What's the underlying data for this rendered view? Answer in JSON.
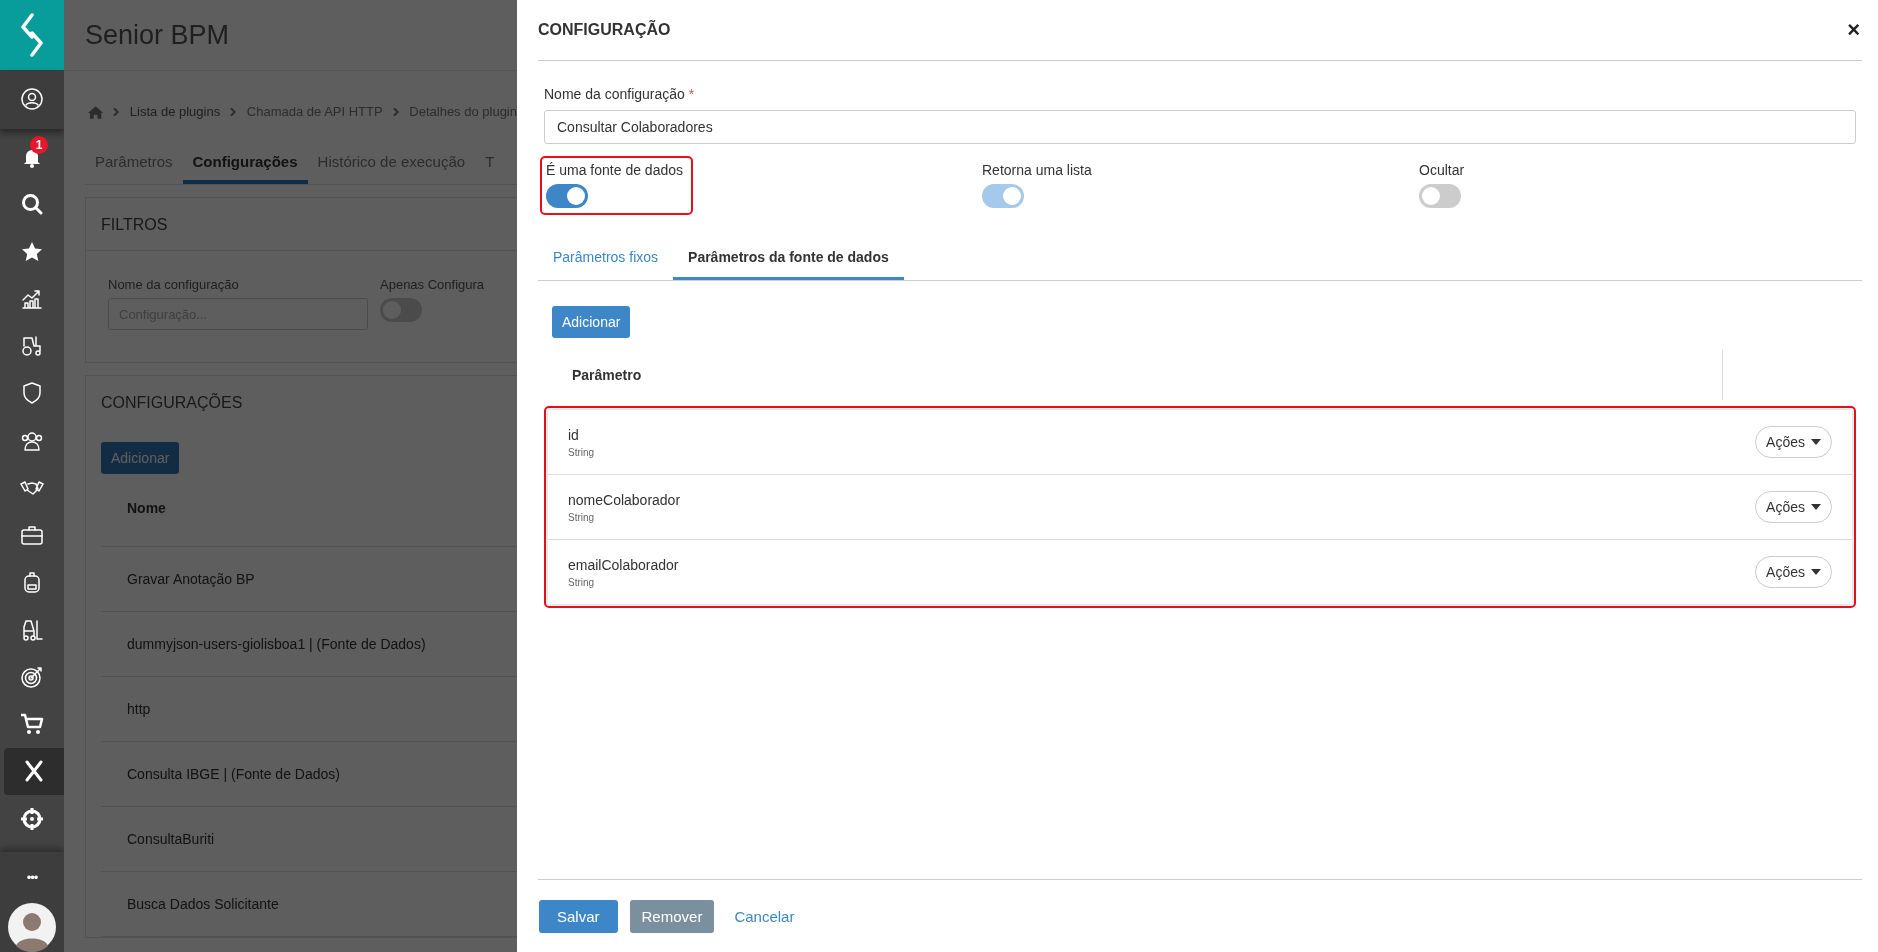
{
  "sidebar": {
    "notification_count": "1",
    "items": [
      {
        "selected": false
      },
      {
        "selected": false
      },
      {
        "selected": false
      },
      {
        "selected": false
      },
      {
        "selected": false
      },
      {
        "selected": false
      },
      {
        "selected": false
      },
      {
        "selected": false
      },
      {
        "selected": false
      },
      {
        "selected": false
      },
      {
        "selected": false
      },
      {
        "selected": false
      },
      {
        "selected": false
      },
      {
        "selected": false
      },
      {
        "selected": true
      },
      {
        "selected": false
      }
    ],
    "more": "•••"
  },
  "background_page": {
    "title": "Senior BPM",
    "breadcrumb": [
      "Lista de plugins",
      "Chamada de API HTTP",
      "Detalhes do plugin"
    ],
    "tabs": [
      {
        "label": "Parâmetros",
        "selected": false
      },
      {
        "label": "Configurações",
        "selected": true
      },
      {
        "label": "Histórico de execução",
        "selected": false
      },
      {
        "label": "T",
        "selected": false
      }
    ],
    "filters": {
      "title": "FILTROS",
      "field_label": "Nome da configuração",
      "placeholder": "Configuração...",
      "toggle_label": "Apenas Configura",
      "toggle_on": false
    },
    "configurations": {
      "title": "CONFIGURAÇÕES",
      "add_button": "Adicionar",
      "column": "Nome",
      "rows": [
        "Gravar Anotação BP",
        "dummyjson-users-giolisboa1 | (Fonte de Dados)",
        "http",
        "Consulta IBGE | (Fonte de Dados)",
        "ConsultaBuriti",
        "Busca Dados Solicitante"
      ]
    }
  },
  "dialog": {
    "title": "CONFIGURAÇÃO",
    "close": "×",
    "name_label": "Nome da configuração",
    "required_mark": "*",
    "name_value": "Consultar Colaboradores",
    "toggles": [
      {
        "label": "É uma fonte de dados",
        "on": true,
        "disabled": false,
        "highlighted": true
      },
      {
        "label": "Retorna uma lista",
        "on": true,
        "disabled": true,
        "highlighted": false
      },
      {
        "label": "Ocultar",
        "on": false,
        "disabled": false,
        "highlighted": false
      }
    ],
    "tabs": [
      {
        "label": "Parâmetros fixos",
        "selected": false
      },
      {
        "label": "Parâmetros da fonte de dados",
        "selected": true
      }
    ],
    "add_button": "Adicionar",
    "column": "Parâmetro",
    "rows_highlighted": true,
    "rows": [
      {
        "name": "id",
        "type": "String",
        "action": "Ações"
      },
      {
        "name": "nomeColaborador",
        "type": "String",
        "action": "Ações"
      },
      {
        "name": "emailColaborador",
        "type": "String",
        "action": "Ações"
      }
    ],
    "footer_buttons": [
      {
        "label": "Salvar",
        "kind": "primary"
      },
      {
        "label": "Remover",
        "kind": "secondary"
      },
      {
        "label": "Cancelar",
        "kind": "link"
      }
    ]
  }
}
